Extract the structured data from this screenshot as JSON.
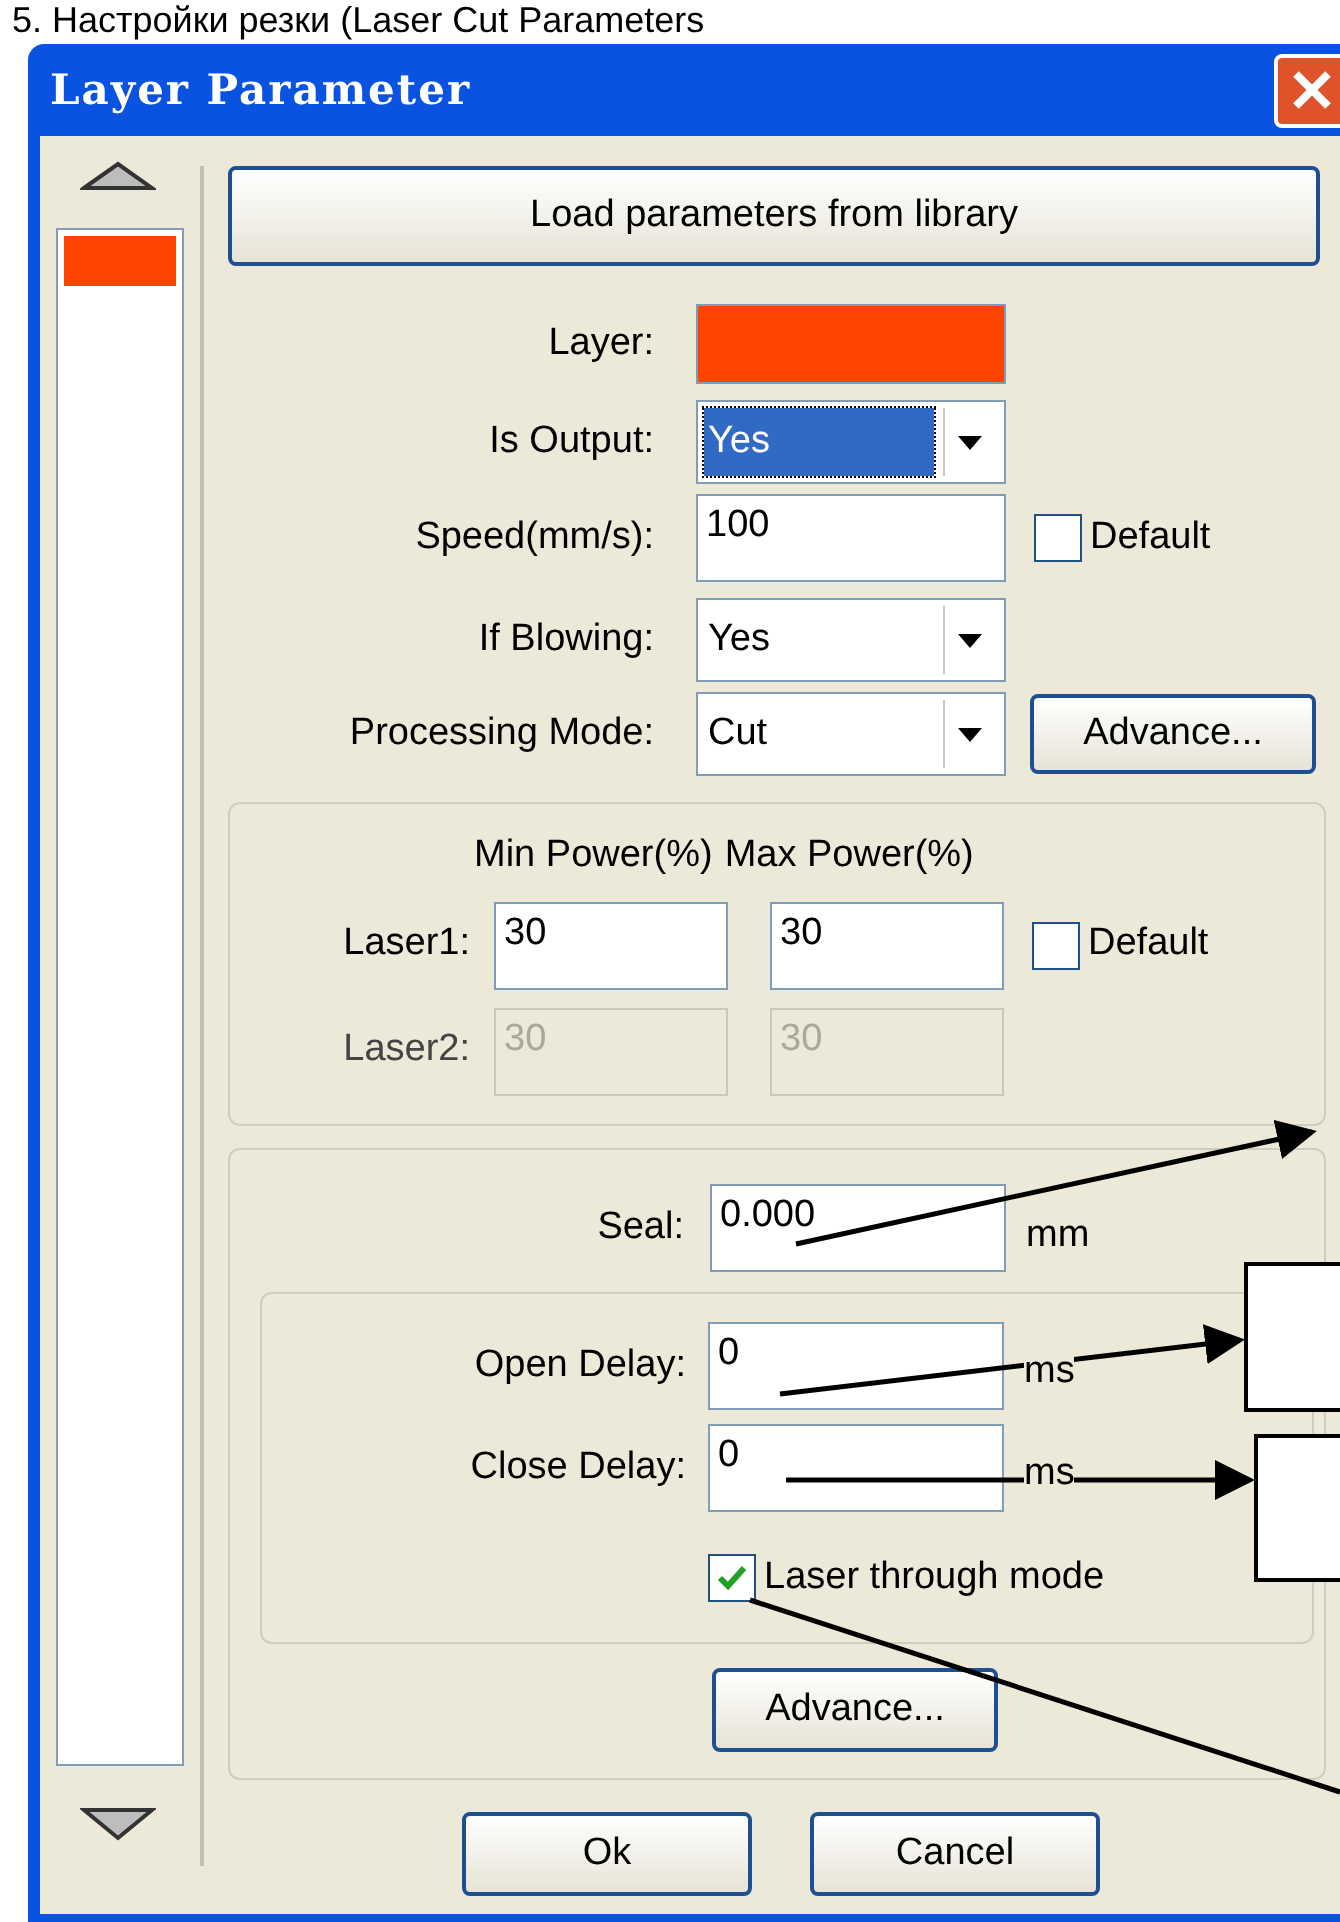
{
  "caption": "5. Настройки резки (Laser Cut Parameters",
  "window": {
    "title": "Layer Parameter"
  },
  "layer_list": [
    {
      "color": "#ff4400"
    }
  ],
  "load_button": "Load parameters from library",
  "form": [
    {
      "kind": "color",
      "label": "Layer:",
      "color": "#ff4400"
    },
    {
      "kind": "dropdown",
      "label": "Is Output:",
      "value": "Yes",
      "focused": true
    },
    {
      "kind": "text",
      "label": "Speed(mm/s):",
      "value": "100",
      "checkbox": {
        "label": "Default",
        "checked": false
      }
    },
    {
      "kind": "dropdown",
      "label": "If Blowing:",
      "value": "Yes",
      "focused": false
    },
    {
      "kind": "dropdown",
      "label": "Processing Mode:",
      "value": "Cut",
      "focused": false,
      "button": "Advance..."
    }
  ],
  "power": {
    "headers": [
      "Min Power(%)",
      "Max Power(%)"
    ],
    "rows": [
      {
        "label": "Laser1:",
        "min": "30",
        "max": "30",
        "disabled": false,
        "checkbox": {
          "label": "Default",
          "checked": false
        }
      },
      {
        "label": "Laser2:",
        "min": "30",
        "max": "30",
        "disabled": true
      }
    ]
  },
  "seal": {
    "label": "Seal:",
    "value": "0.000",
    "unit": "mm"
  },
  "delays": [
    {
      "label": "Open Delay:",
      "value": "0",
      "unit": "ms"
    },
    {
      "label": "Close Delay:",
      "value": "0",
      "unit": "ms"
    }
  ],
  "through_mode": {
    "label": "Laser through mode",
    "checked": true
  },
  "advance_button": "Advance...",
  "buttons": [
    "Ok",
    "Cancel"
  ]
}
